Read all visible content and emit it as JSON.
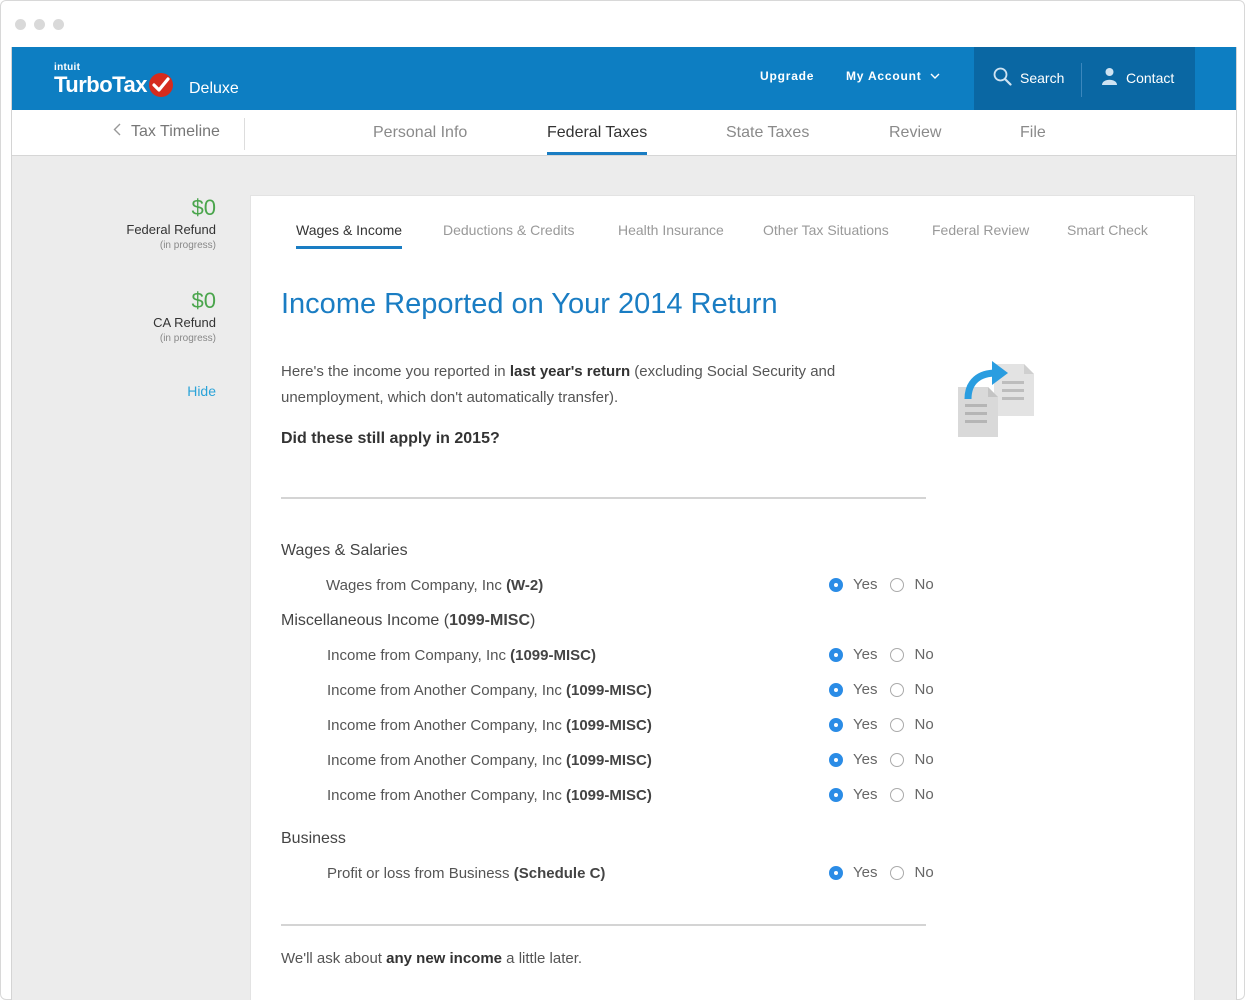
{
  "header": {
    "brand_small": "intuit",
    "brand": "TurboTax",
    "edition": "Deluxe",
    "upgrade": "Upgrade",
    "my_account": "My Account",
    "search": "Search",
    "contact": "Contact",
    "brand_color": "#0d7ec2",
    "accent_dark": "#0a67a3"
  },
  "nav": {
    "back": "Tax Timeline",
    "items": [
      {
        "label": "Personal Info",
        "active": false
      },
      {
        "label": "Federal Taxes",
        "active": true
      },
      {
        "label": "State Taxes",
        "active": false
      },
      {
        "label": "Review",
        "active": false
      },
      {
        "label": "File",
        "active": false
      }
    ]
  },
  "sidebar": {
    "refunds": [
      {
        "amount": "$0",
        "label": "Federal Refund",
        "status": "(in progress)"
      },
      {
        "amount": "$0",
        "label": "CA Refund",
        "status": "(in progress)"
      }
    ],
    "hide": "Hide"
  },
  "subtabs": [
    {
      "label": "Wages & Income",
      "active": true
    },
    {
      "label": "Deductions & Credits",
      "active": false
    },
    {
      "label": "Health Insurance",
      "active": false
    },
    {
      "label": "Other Tax Situations",
      "active": false
    },
    {
      "label": "Federal Review",
      "active": false
    },
    {
      "label": "Smart Check",
      "active": false
    }
  ],
  "main": {
    "title": "Income Reported on Your 2014 Return",
    "intro_pre": "Here's the income you reported in ",
    "intro_bold": "last year's return",
    "intro_post": " (excluding Social Security and unemployment, which don't automatically transfer).",
    "question": "Did these still apply in 2015?",
    "yes": "Yes",
    "no": "No",
    "sections": {
      "wages": {
        "title": "Wages & Salaries",
        "rows": [
          {
            "label": "Wages from Company, Inc ",
            "form": "(W-2)",
            "answer": "yes"
          }
        ]
      },
      "misc": {
        "title_pre": "Miscellaneous Income (",
        "title_bold": "1099-MISC",
        "title_post": ")",
        "rows": [
          {
            "label": "Income from  Company, Inc ",
            "form": "(1099-MISC)",
            "answer": "yes"
          },
          {
            "label": "Income from Another Company, Inc ",
            "form": "(1099-MISC)",
            "answer": "yes"
          },
          {
            "label": "Income from Another Company, Inc ",
            "form": "(1099-MISC)",
            "answer": "yes"
          },
          {
            "label": "Income from Another Company, Inc ",
            "form": "(1099-MISC)",
            "answer": "yes"
          },
          {
            "label": "Income from Another Company, Inc ",
            "form": "(1099-MISC)",
            "answer": "yes"
          }
        ]
      },
      "business": {
        "title": "Business",
        "rows": [
          {
            "label": "Profit or loss from Business ",
            "form": "(Schedule C)",
            "answer": "yes"
          }
        ]
      }
    },
    "footer_pre": "We'll ask about ",
    "footer_bold": "any new income",
    "footer_post": " a little later."
  }
}
